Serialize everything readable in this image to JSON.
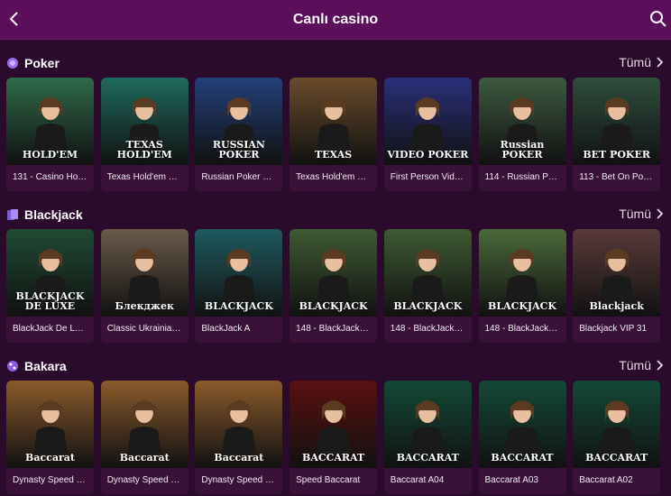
{
  "header": {
    "title": "Canlı casino",
    "back_icon": "chevron-left-icon",
    "search_icon": "search-icon"
  },
  "colors": {
    "header_bg": "#5b0f5a",
    "page_bg": "#2b0b2b",
    "card_bg": "#3a1239"
  },
  "sections": [
    {
      "title": "Poker",
      "icon": "poker-chip-icon",
      "all_label": "Tümü",
      "games": [
        {
          "caption": "131 - Casino Hold…",
          "logo": "HOLD'EM",
          "bg": "#2f6a4a"
        },
        {
          "caption": "Texas Hold'em M…",
          "logo": "TEXAS HOLD'EM",
          "bg": "#1e6a5e"
        },
        {
          "caption": "Russian Poker VIP",
          "logo": "RUSSIAN POKER",
          "bg": "#23407a"
        },
        {
          "caption": "Texas Hold'em B…",
          "logo": "TEXAS",
          "bg": "#6a4b2a"
        },
        {
          "caption": "First Person Vide…",
          "logo": "VIDEO POKER",
          "bg": "#2a2f7a"
        },
        {
          "caption": "114 - Russian Pok…",
          "logo": "Russian POKER",
          "bg": "#3d5a40"
        },
        {
          "caption": "113 - Bet On Poker",
          "logo": "BET POKER",
          "bg": "#2e4e3e"
        }
      ]
    },
    {
      "title": "Blackjack",
      "icon": "cards-icon",
      "all_label": "Tümü",
      "games": [
        {
          "caption": "BlackJack De Lux…",
          "logo": "BLACKJACK DE LUXE",
          "bg": "#1f4a33"
        },
        {
          "caption": "Classic Ukrainian …",
          "logo": "Блекджек",
          "bg": "#6a5a4a"
        },
        {
          "caption": "BlackJack A",
          "logo": "BLACKJACK",
          "bg": "#1f5a60"
        },
        {
          "caption": "148 - BlackJack C…",
          "logo": "BLACKJACK",
          "bg": "#3e5a32"
        },
        {
          "caption": "148 - BlackJack C…",
          "logo": "BLACKJACK",
          "bg": "#3e5a32"
        },
        {
          "caption": "148 - BlackJack C…",
          "logo": "BLACKJACK",
          "bg": "#4a6a3a"
        },
        {
          "caption": "Blackjack VIP 31",
          "logo": "Blackjack",
          "bg": "#5a3a3a"
        }
      ]
    },
    {
      "title": "Bakara",
      "icon": "dice-icon",
      "all_label": "Tümü",
      "games": [
        {
          "caption": "Dynasty Speed B…",
          "logo": "Baccarat",
          "bg": "#8a5a2a"
        },
        {
          "caption": "Dynasty Speed B…",
          "logo": "Baccarat",
          "bg": "#8a5a2a"
        },
        {
          "caption": "Dynasty Speed B…",
          "logo": "Baccarat",
          "bg": "#8a5a2a"
        },
        {
          "caption": "Speed Baccarat",
          "logo": "BACCARAT",
          "bg": "#5a1010"
        },
        {
          "caption": "Baccarat A04",
          "logo": "BACCARAT",
          "bg": "#134a36"
        },
        {
          "caption": "Baccarat A03",
          "logo": "BACCARAT",
          "bg": "#134a36"
        },
        {
          "caption": "Baccarat A02",
          "logo": "BACCARAT",
          "bg": "#134a36"
        }
      ]
    }
  ]
}
